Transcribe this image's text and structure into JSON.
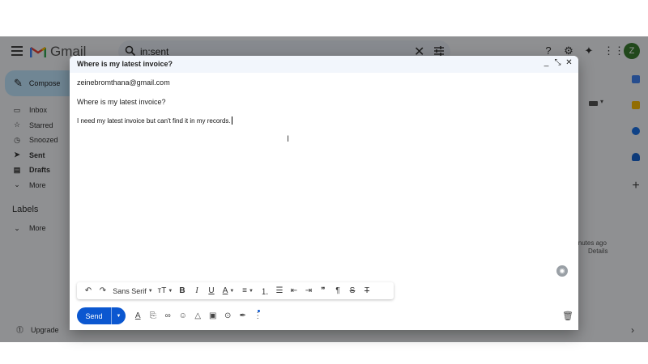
{
  "app": {
    "name": "Gmail",
    "search_query": "in:sent",
    "avatar_letter": "Z",
    "brand_color": "#0b57d0",
    "compose_label": "Compose",
    "nav": [
      {
        "label": "Inbox",
        "icon": "inbox-icon",
        "glyph": "▭",
        "active": false
      },
      {
        "label": "Starred",
        "icon": "star-icon",
        "glyph": "☆",
        "active": false
      },
      {
        "label": "Snoozed",
        "icon": "clock-icon",
        "glyph": "◷",
        "active": false
      },
      {
        "label": "Sent",
        "icon": "send-icon",
        "glyph": "➤",
        "active": true
      },
      {
        "label": "Drafts",
        "icon": "draft-icon",
        "glyph": "▤",
        "active": true
      },
      {
        "label": "More",
        "icon": "chevron-down-icon",
        "glyph": "⌄",
        "active": false
      }
    ],
    "labels_heading": "Labels",
    "labels_more": "More",
    "upgrade_label": "Upgrade",
    "bg_time_partial": "inutes ago",
    "bg_details": "Details"
  },
  "compose": {
    "title": "Where is my latest invoice?",
    "to": "zeinebromthana@gmail.com",
    "subject": "Where is my latest invoice?",
    "body": "I need my latest invoice but can't find it in my records.",
    "font_name": "Sans Serif",
    "send_label": "Send"
  }
}
